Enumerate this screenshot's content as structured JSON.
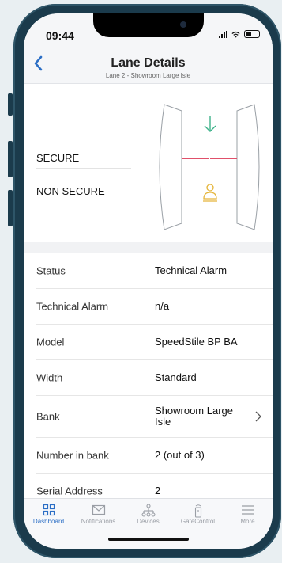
{
  "status_bar": {
    "time": "09:44"
  },
  "nav": {
    "title": "Lane Details",
    "subtitle": "Lane 2 - Showroom Large Isle"
  },
  "lane": {
    "states": [
      "SECURE",
      "NON SECURE"
    ],
    "colors": {
      "secure_arrow": "#3db28a",
      "barrier": "#e0506a",
      "person": "#e5b53a"
    }
  },
  "details": [
    {
      "label": "Status",
      "value": "Technical Alarm"
    },
    {
      "label": "Technical Alarm",
      "value": "n/a"
    },
    {
      "label": "Model",
      "value": "SpeedStile BP BA"
    },
    {
      "label": "Width",
      "value": "Standard"
    },
    {
      "label": "Bank",
      "value": "Showroom Large Isle"
    },
    {
      "label": "Number in bank",
      "value": "2 (out of 3)"
    },
    {
      "label": "Serial Address",
      "value": "2"
    }
  ],
  "tabs": [
    {
      "label": "Dashboard",
      "icon": "grid-icon"
    },
    {
      "label": "Notifications",
      "icon": "envelope-icon"
    },
    {
      "label": "Devices",
      "icon": "network-icon"
    },
    {
      "label": "GateControl",
      "icon": "remote-icon"
    },
    {
      "label": "More",
      "icon": "menu-icon"
    }
  ],
  "colors": {
    "accent": "#2b6ec5",
    "frame": "#1b3b4c"
  }
}
